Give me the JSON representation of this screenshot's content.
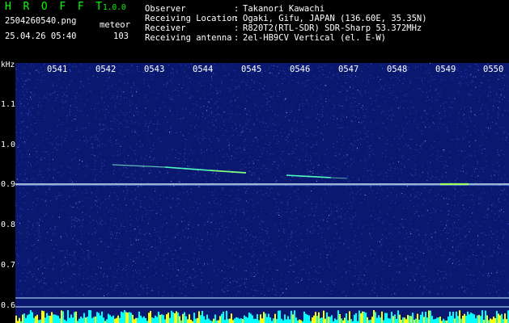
{
  "app": {
    "name": "H R O F F T",
    "version": "1.0.0"
  },
  "file": {
    "name": "2504260540.png",
    "datetime": "25.04.26 05:40"
  },
  "detection": {
    "label": "meteor",
    "count": "103"
  },
  "info": [
    {
      "label": "Observer",
      "value": "Takanori Kawachi"
    },
    {
      "label": "Receiving Location",
      "value": "Ogaki, Gifu, JAPAN (136.60E, 35.35N)"
    },
    {
      "label": "Receiver",
      "value": "R820T2(RTL-SDR) SDR-Sharp 53.372MHz"
    },
    {
      "label": "Receiving antenna",
      "value": "2el-HB9CV Vertical (el. E-W)"
    }
  ],
  "separator": ":",
  "axis": {
    "unit": "kHz",
    "y_ticks": [
      "1.1",
      "1.0",
      "0.9",
      "0.8",
      "0.7",
      "0.6"
    ],
    "x_ticks": [
      "0541",
      "0542",
      "0543",
      "0544",
      "0545",
      "0546",
      "0547",
      "0548",
      "0549",
      "0550"
    ]
  },
  "colors": {
    "background": "#000000",
    "spectrogram": "#0a1870",
    "noise": "#3a5ad8",
    "carrier": "#dfffff",
    "meteor": "#50ffc0",
    "title": "#00ff00",
    "baseline": "#00ffff",
    "burst": "#ffff00"
  }
}
